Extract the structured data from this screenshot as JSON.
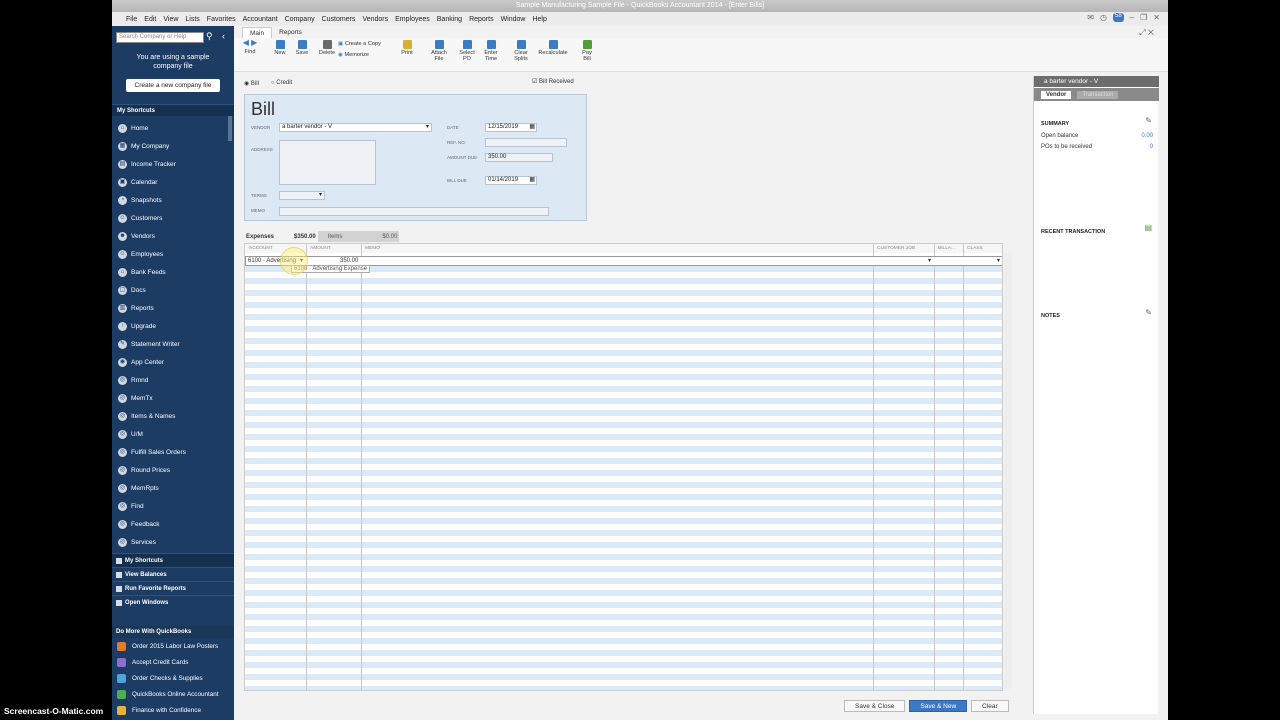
{
  "window": {
    "title": "Sample Manufacturing Sample File - QuickBooks Accountant 2014 - [Enter Bills]"
  },
  "menu": [
    "File",
    "Edit",
    "View",
    "Lists",
    "Favorites",
    "Accountant",
    "Company",
    "Customers",
    "Vendors",
    "Employees",
    "Banking",
    "Reports",
    "Window",
    "Help"
  ],
  "menu_badge": "58",
  "sidebar": {
    "search_placeholder": "Search Company or Help",
    "sample_msg": "You are using a sample company file",
    "new_file_button": "Create a new company file",
    "shortcuts_title": "My Shortcuts",
    "items": [
      "Home",
      "My Company",
      "Income Tracker",
      "Calendar",
      "Snapshots",
      "Customers",
      "Vendors",
      "Employees",
      "Bank Feeds",
      "Docs",
      "Reports",
      "Upgrade",
      "Statement Writer",
      "App Center",
      "Rmnd",
      "MemTx",
      "Items & Names",
      "U/M",
      "Fulfill Sales Orders",
      "Round Prices",
      "MemRpts",
      "Find",
      "Feedback",
      "Services"
    ],
    "panels": [
      "My Shortcuts",
      "View Balances",
      "Run Favorite Reports",
      "Open Windows"
    ],
    "more_title": "Do More With QuickBooks",
    "more_items": [
      "Order 2015 Labor Law Posters",
      "Accept Credit Cards",
      "Order Checks & Supplies",
      "QuickBooks Online Accountant",
      "Finance with Confidence"
    ]
  },
  "tabs": [
    "Main",
    "Reports"
  ],
  "ribbon": {
    "find": "Find",
    "new": "New",
    "save": "Save",
    "delete": "Delete",
    "create_copy": "Create a Copy",
    "memorize": "Memorize",
    "print": "Print",
    "attach": "Attach File",
    "select_po": "Select PO",
    "enter_time": "Enter Time",
    "clear_splits": "Clear Splits",
    "recalculate": "Recalculate",
    "pay_bill": "Pay Bill"
  },
  "form": {
    "radio_bill": "Bill",
    "radio_credit": "Credit",
    "bill_received": "Bill Received",
    "title": "Bill",
    "vendor_label": "VENDOR",
    "vendor_value": "a barter vendor - V",
    "address_label": "ADDRESS",
    "terms_label": "TERMS",
    "memo_label": "MEMO",
    "date_label": "DATE",
    "date_value": "12/15/2019",
    "ref_label": "REF. NO.",
    "amount_due_label": "AMOUNT DUE",
    "amount_due_value": "350.00",
    "bill_due_label": "BILL DUE",
    "bill_due_value": "01/14/2019"
  },
  "expenses": {
    "tab_expenses": "Expenses",
    "expenses_total": "$350.00",
    "tab_items": "Items",
    "items_total": "$0.00",
    "columns": [
      "ACCOUNT",
      "AMOUNT",
      "MEMO",
      "CUSTOMER:JOB",
      "BILLA...",
      "CLASS"
    ],
    "row_account": "6100 · Advertising",
    "row_amount": "350.00",
    "dropdown_hint": "6100 · Advertising Expense"
  },
  "buttons": {
    "save_close": "Save & Close",
    "save_new": "Save & New",
    "clear": "Clear"
  },
  "right_panel": {
    "header": "a barter vendor - V",
    "tab_vendor": "Vendor",
    "tab_transaction": "Transaction",
    "summary": "SUMMARY",
    "open_balance_label": "Open balance",
    "open_balance_value": "0.00",
    "pos_label": "POs to be received",
    "pos_value": "0",
    "recent": "RECENT TRANSACTION",
    "notes": "NOTES"
  },
  "watermark": "Screencast-O-Matic.com"
}
